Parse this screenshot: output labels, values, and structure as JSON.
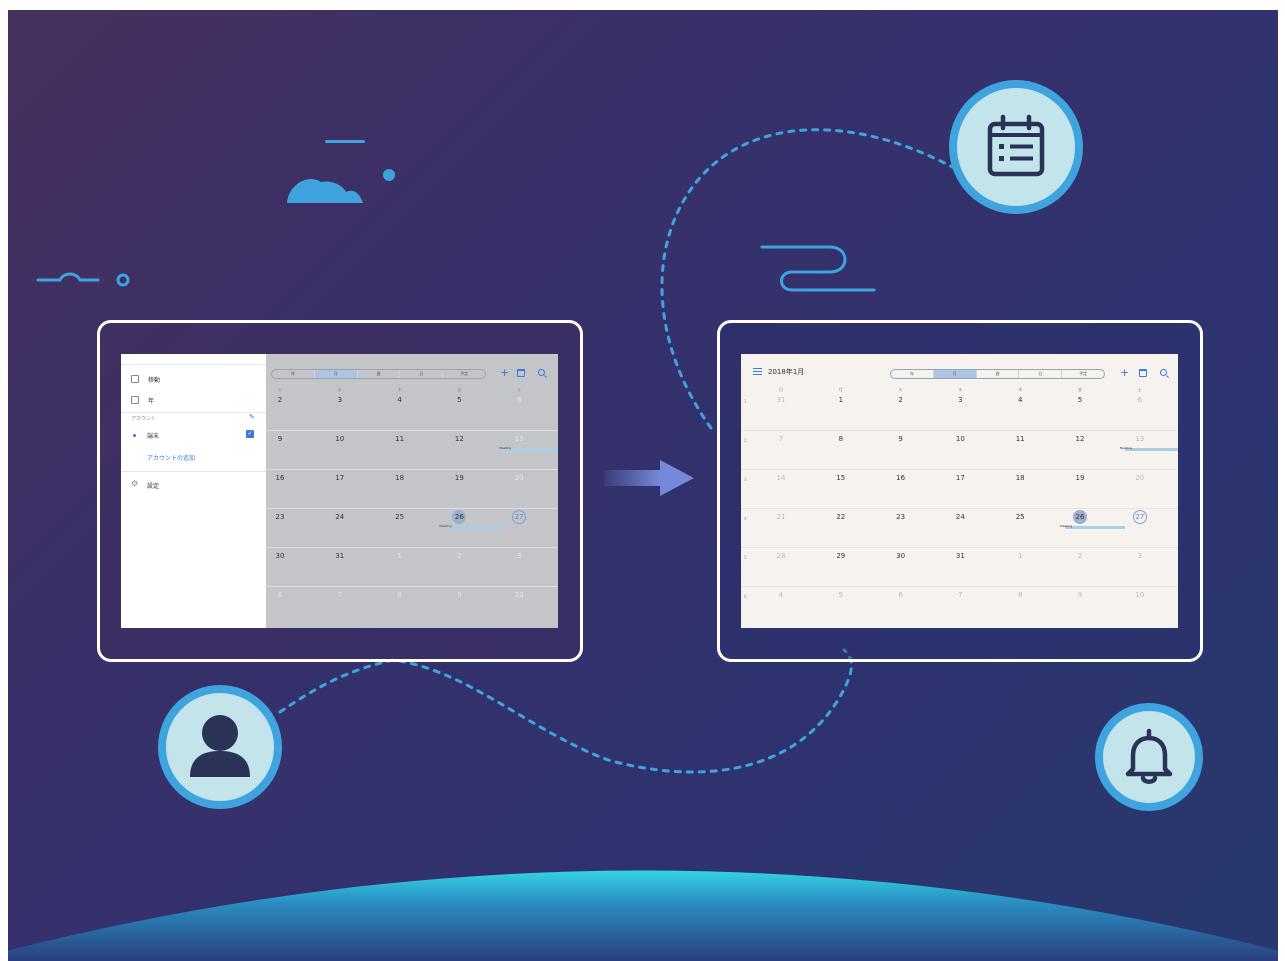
{
  "colors": {
    "background_gradient": [
      "#47305d",
      "#27386e"
    ],
    "accent": "#3fa3e0",
    "badge_fill": "#c2e4ea",
    "icon_dark": "#2b3257",
    "planet_cyan": "#33cfe0"
  },
  "icons": [
    "cloud-icon",
    "wind-icon",
    "user-icon",
    "calendar-list-icon",
    "bell-icon",
    "arrow-right-icon"
  ],
  "left_screen": {
    "drawer": {
      "items": [
        {
          "icon": "move-icon",
          "label": "移動"
        },
        {
          "icon": "year-icon",
          "label": "年"
        }
      ],
      "accounts_header": "アカウント",
      "account_name": "端末",
      "add_account": "アカウントの追加",
      "settings": "設定"
    },
    "view_tabs": [
      "年",
      "月",
      "週",
      "日",
      "予定"
    ],
    "selected_tab": "月",
    "weekdays": [
      "火",
      "水",
      "木",
      "金",
      "土"
    ],
    "weeks": [
      [
        {
          "d": "2",
          "in": true
        },
        {
          "d": "3",
          "in": true
        },
        {
          "d": "4",
          "in": true
        },
        {
          "d": "5",
          "in": true
        },
        {
          "d": "6",
          "in": false
        }
      ],
      [
        {
          "d": "9",
          "in": true
        },
        {
          "d": "10",
          "in": true
        },
        {
          "d": "11",
          "in": true
        },
        {
          "d": "12",
          "in": true
        },
        {
          "d": "13",
          "in": false
        }
      ],
      [
        {
          "d": "16",
          "in": true
        },
        {
          "d": "17",
          "in": true
        },
        {
          "d": "18",
          "in": true
        },
        {
          "d": "19",
          "in": true
        },
        {
          "d": "20",
          "in": false
        }
      ],
      [
        {
          "d": "23",
          "in": true
        },
        {
          "d": "24",
          "in": true
        },
        {
          "d": "25",
          "in": true
        },
        {
          "d": "26",
          "in": true
        },
        {
          "d": "27",
          "in": true
        }
      ],
      [
        {
          "d": "30",
          "in": true
        },
        {
          "d": "31",
          "in": true
        },
        {
          "d": "1",
          "in": false
        },
        {
          "d": "2",
          "in": false
        },
        {
          "d": "3",
          "in": false
        }
      ],
      [
        {
          "d": "6",
          "in": false
        },
        {
          "d": "7",
          "in": false
        },
        {
          "d": "8",
          "in": false
        },
        {
          "d": "9",
          "in": false
        },
        {
          "d": "10",
          "in": false
        }
      ]
    ],
    "selected_day": "26",
    "today": "27",
    "events": [
      {
        "label": "Meeting",
        "week": 1,
        "col": 4
      },
      {
        "label": "Meeting",
        "week": 3,
        "col": 3
      }
    ]
  },
  "right_screen": {
    "title": "2018年1月",
    "view_tabs": [
      "年",
      "月",
      "週",
      "日",
      "予定"
    ],
    "selected_tab": "月",
    "weekdays": [
      "日",
      "月",
      "火",
      "水",
      "木",
      "金",
      "土"
    ],
    "week_numbers": [
      "1",
      "2",
      "3",
      "4",
      "5",
      "6"
    ],
    "weeks": [
      [
        {
          "d": "31",
          "in": false
        },
        {
          "d": "1",
          "in": true
        },
        {
          "d": "2",
          "in": true
        },
        {
          "d": "3",
          "in": true
        },
        {
          "d": "4",
          "in": true
        },
        {
          "d": "5",
          "in": true
        },
        {
          "d": "6",
          "in": false
        }
      ],
      [
        {
          "d": "7",
          "in": false
        },
        {
          "d": "8",
          "in": true
        },
        {
          "d": "9",
          "in": true
        },
        {
          "d": "10",
          "in": true
        },
        {
          "d": "11",
          "in": true
        },
        {
          "d": "12",
          "in": true
        },
        {
          "d": "13",
          "in": false
        }
      ],
      [
        {
          "d": "14",
          "in": false
        },
        {
          "d": "15",
          "in": true
        },
        {
          "d": "16",
          "in": true
        },
        {
          "d": "17",
          "in": true
        },
        {
          "d": "18",
          "in": true
        },
        {
          "d": "19",
          "in": true
        },
        {
          "d": "20",
          "in": false
        }
      ],
      [
        {
          "d": "21",
          "in": false
        },
        {
          "d": "22",
          "in": true
        },
        {
          "d": "23",
          "in": true
        },
        {
          "d": "24",
          "in": true
        },
        {
          "d": "25",
          "in": true
        },
        {
          "d": "26",
          "in": true
        },
        {
          "d": "27",
          "in": true
        }
      ],
      [
        {
          "d": "28",
          "in": false
        },
        {
          "d": "29",
          "in": true
        },
        {
          "d": "30",
          "in": true
        },
        {
          "d": "31",
          "in": true
        },
        {
          "d": "1",
          "in": false
        },
        {
          "d": "2",
          "in": false
        },
        {
          "d": "3",
          "in": false
        }
      ],
      [
        {
          "d": "4",
          "in": false
        },
        {
          "d": "5",
          "in": false
        },
        {
          "d": "6",
          "in": false
        },
        {
          "d": "7",
          "in": false
        },
        {
          "d": "8",
          "in": false
        },
        {
          "d": "9",
          "in": false
        },
        {
          "d": "10",
          "in": false
        }
      ]
    ],
    "selected_day": "26",
    "today": "27",
    "events": [
      {
        "label": "Meeting",
        "week": 1,
        "col": 6
      },
      {
        "label": "Meeting",
        "week": 3,
        "col": 5
      }
    ]
  }
}
